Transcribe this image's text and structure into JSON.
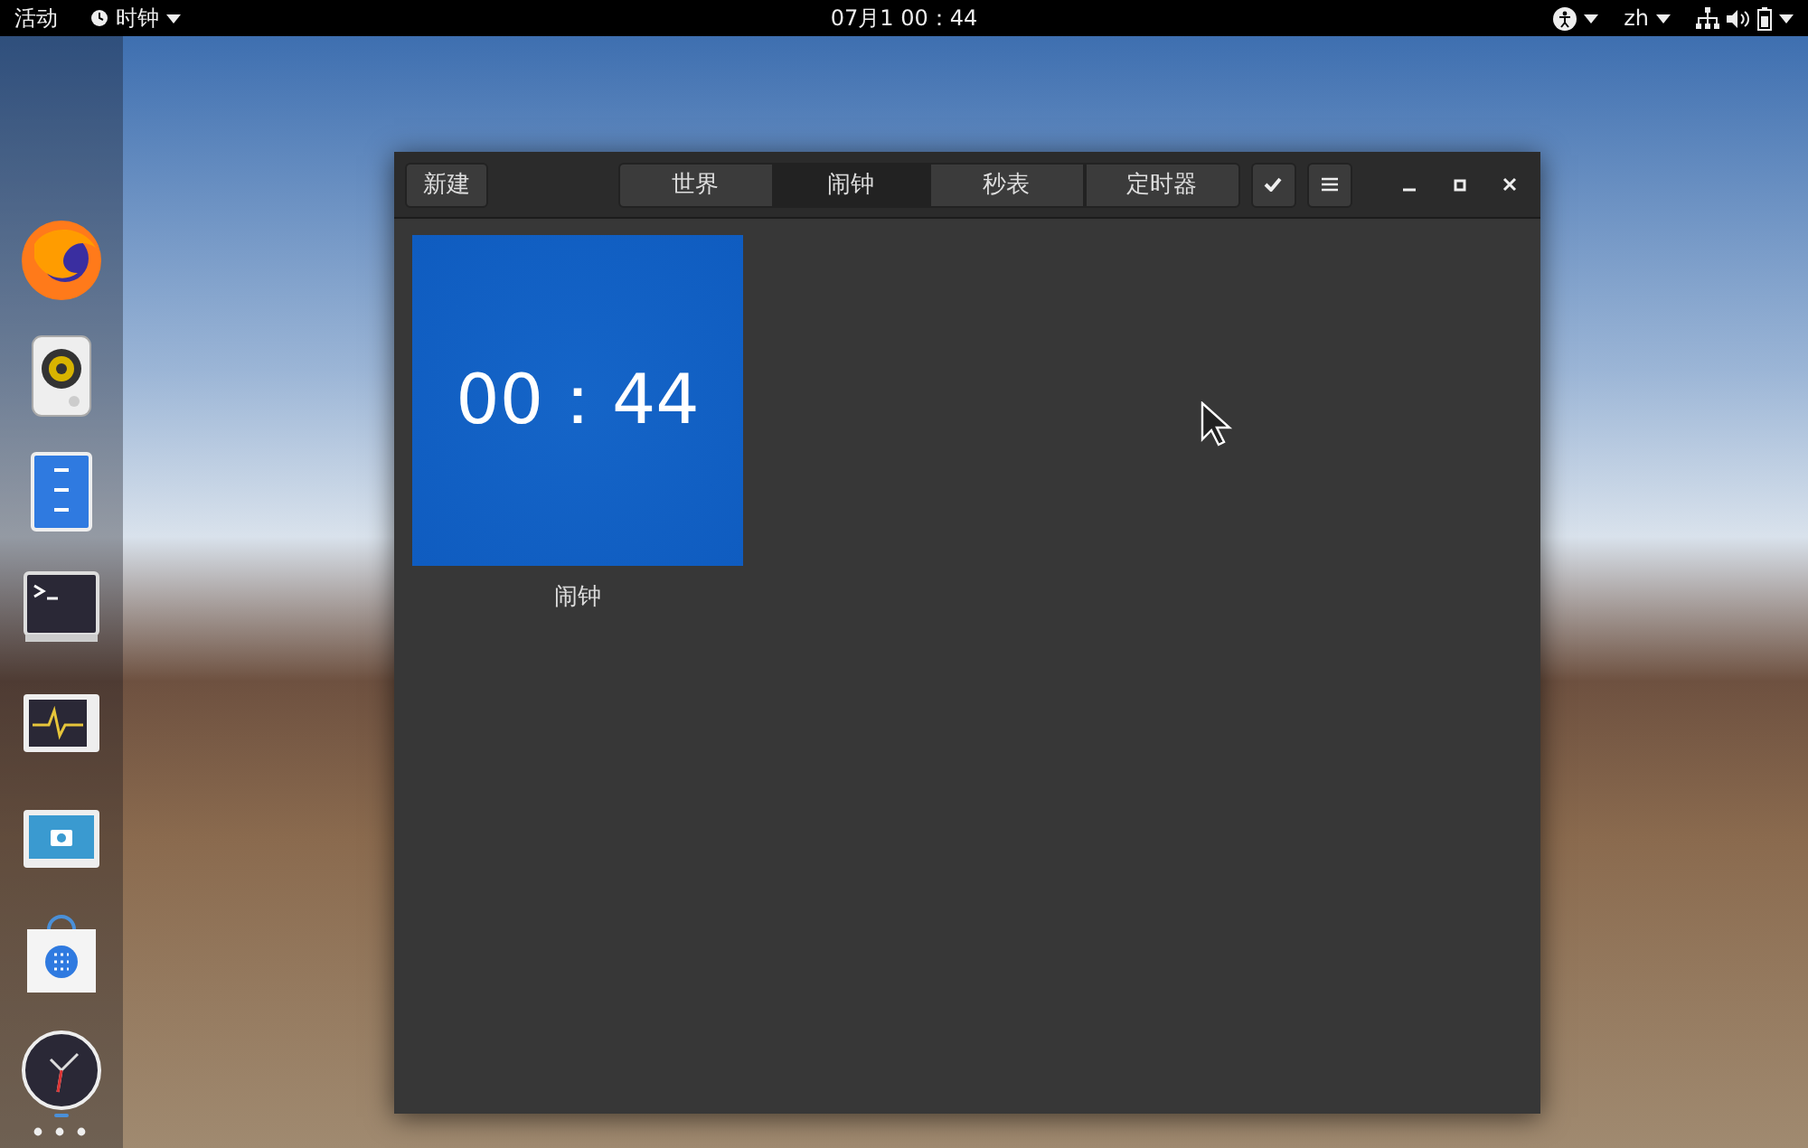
{
  "top_bar": {
    "activities": "活动",
    "app_menu": "时钟",
    "clock": "07月1 00：44",
    "input_method": "zh"
  },
  "dock": {
    "apps": [
      {
        "kind": "browser",
        "running": false
      },
      {
        "kind": "speaker",
        "running": false
      },
      {
        "kind": "files",
        "running": false
      },
      {
        "kind": "terminal",
        "running": false
      },
      {
        "kind": "monitor",
        "running": false
      },
      {
        "kind": "camera",
        "running": false
      },
      {
        "kind": "store",
        "running": false
      },
      {
        "kind": "clock",
        "running": true
      }
    ]
  },
  "window": {
    "new_button": "新建",
    "tabs": [
      {
        "label": "世界",
        "selected": false
      },
      {
        "label": "闹钟",
        "selected": true
      },
      {
        "label": "秒表",
        "selected": false
      },
      {
        "label": "定时器",
        "selected": false
      }
    ],
    "alarms": [
      {
        "time": "00：44",
        "name": "闹钟"
      }
    ]
  }
}
